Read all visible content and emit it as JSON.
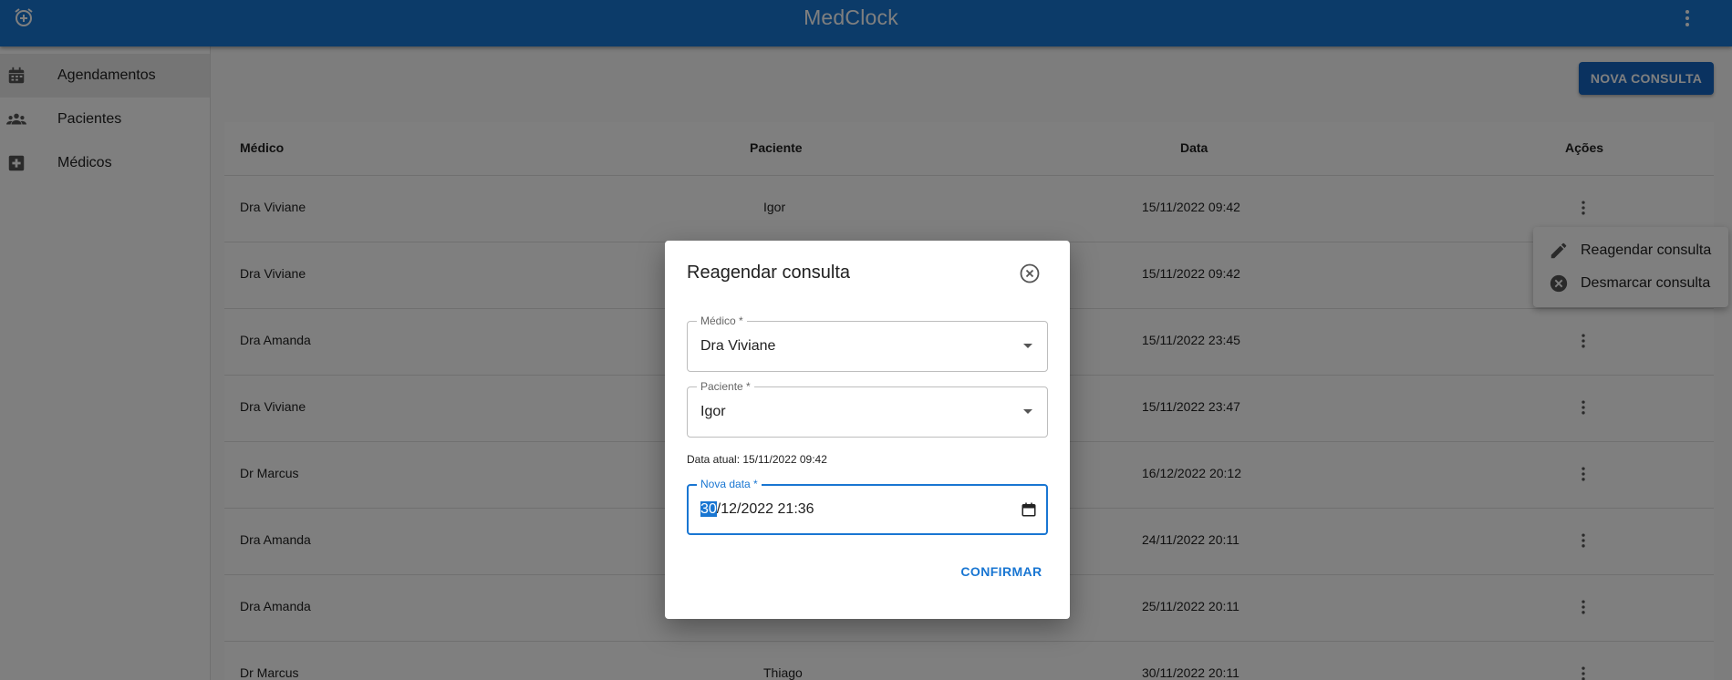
{
  "app": {
    "title": "MedClock",
    "left_icon": "alarm-add-icon",
    "menu_icon": "more-vert-icon",
    "accent": "#1976d2"
  },
  "sidebar": {
    "items": [
      {
        "label": "Agendamentos",
        "icon": "calendar-icon",
        "active": true
      },
      {
        "label": "Pacientes",
        "icon": "people-icon",
        "active": false
      },
      {
        "label": "Médicos",
        "icon": "medical-cross-icon",
        "active": false
      }
    ]
  },
  "toolbar": {
    "new_label": "NOVA CONSULTA"
  },
  "table": {
    "headers": [
      "Médico",
      "Paciente",
      "Data",
      "Ações"
    ],
    "rows": [
      {
        "medico": "Dra Viviane",
        "paciente": "Igor",
        "data": "15/11/2022 09:42"
      },
      {
        "medico": "Dra Viviane",
        "paciente": "",
        "data": "15/11/2022 09:42"
      },
      {
        "medico": "Dra Amanda",
        "paciente": "",
        "data": "15/11/2022 23:45"
      },
      {
        "medico": "Dra Viviane",
        "paciente": "",
        "data": "15/11/2022 23:47"
      },
      {
        "medico": "Dr Marcus",
        "paciente": "",
        "data": "16/12/2022 20:12"
      },
      {
        "medico": "Dra Amanda",
        "paciente": "",
        "data": "24/11/2022 20:11"
      },
      {
        "medico": "Dra Amanda",
        "paciente": "",
        "data": "25/11/2022 20:11"
      },
      {
        "medico": "Dr Marcus",
        "paciente": "Thiago",
        "data": "30/11/2022 20:11"
      }
    ]
  },
  "popmenu": {
    "items": [
      {
        "label": "Reagendar consulta",
        "icon": "pencil-icon"
      },
      {
        "label": "Desmarcar consulta",
        "icon": "cancel-circle-icon"
      }
    ]
  },
  "dialog": {
    "title": "Reagendar consulta",
    "medico": {
      "label": "Médico *",
      "value": "Dra Viviane"
    },
    "paciente": {
      "label": "Paciente *",
      "value": "Igor"
    },
    "data_atual": "Data atual: 15/11/2022 09:42",
    "nova_data": {
      "label": "Nova data *",
      "day": "30",
      "rest": "/12/2022 21:36"
    },
    "confirm_label": "CONFIRMAR"
  }
}
